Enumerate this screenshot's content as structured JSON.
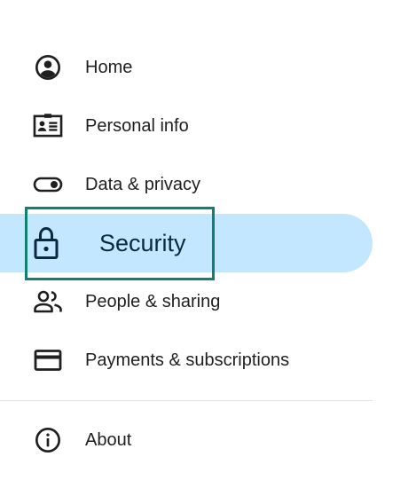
{
  "nav": {
    "items": [
      {
        "label": "Home",
        "icon": "account-circle-icon"
      },
      {
        "label": "Personal info",
        "icon": "id-card-icon"
      },
      {
        "label": "Data & privacy",
        "icon": "toggle-icon"
      },
      {
        "label": "Security",
        "icon": "lock-icon",
        "active": true
      },
      {
        "label": "People & sharing",
        "icon": "people-icon"
      },
      {
        "label": "Payments & subscriptions",
        "icon": "credit-card-icon"
      }
    ],
    "footer_items": [
      {
        "label": "About",
        "icon": "info-icon"
      }
    ]
  },
  "colors": {
    "active_background": "#c2e7ff",
    "focus_ring": "#12806f",
    "text": "#1f1f1f",
    "divider": "#e2e2e2"
  }
}
